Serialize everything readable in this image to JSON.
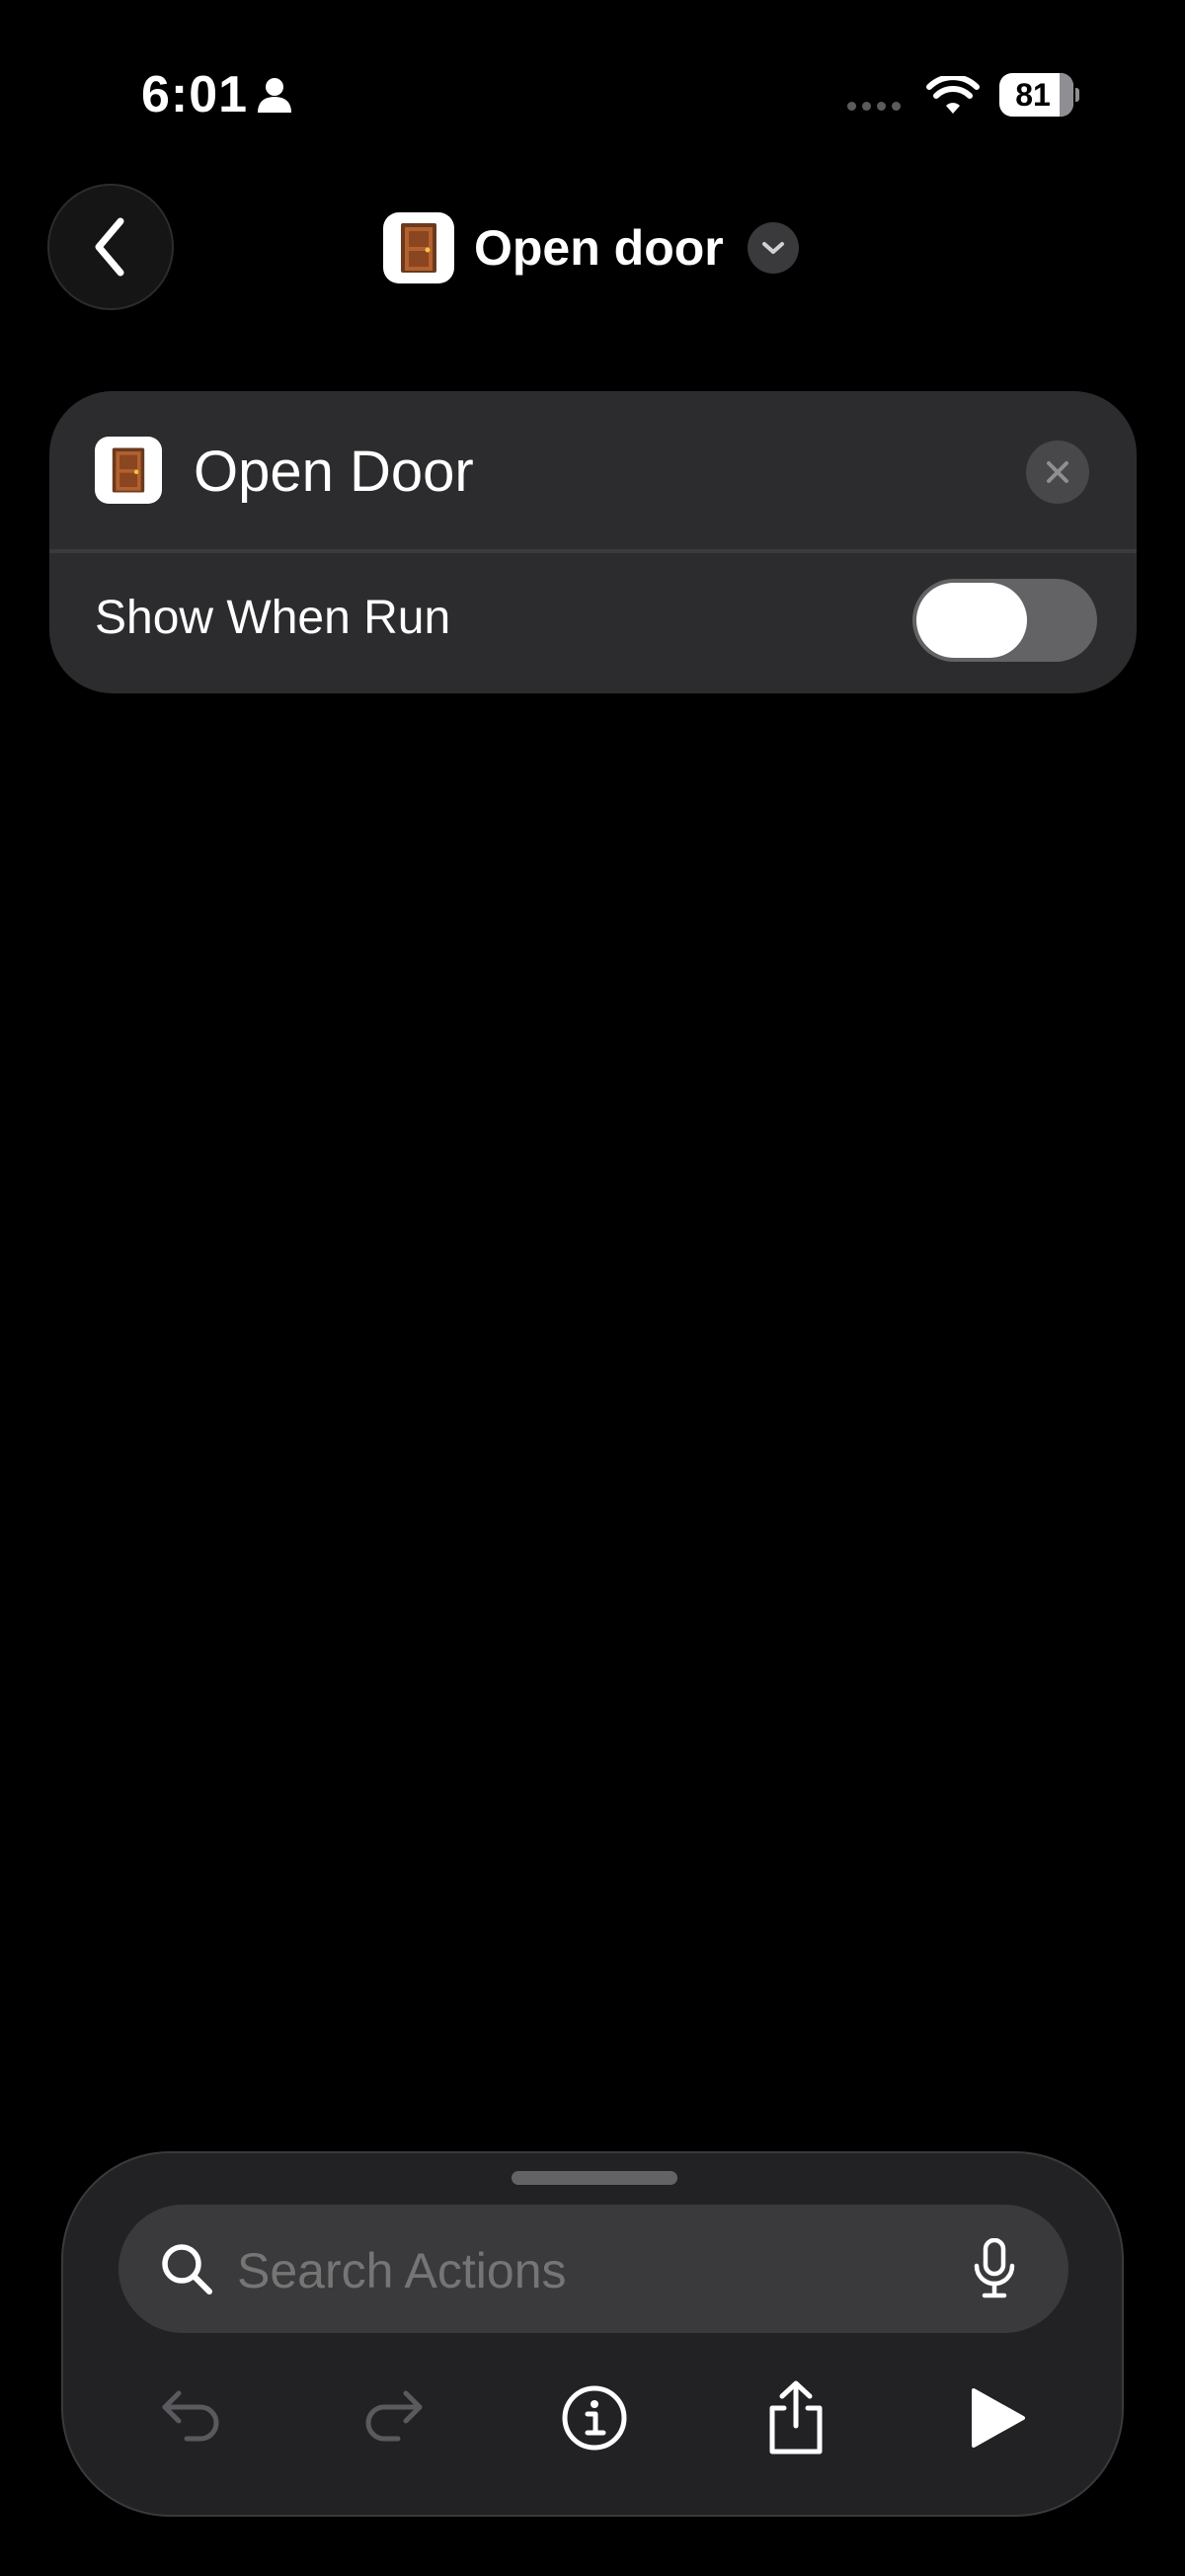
{
  "status_bar": {
    "time": "6:01",
    "battery_level": "81",
    "battery_fraction": 0.81
  },
  "nav": {
    "title": "Open door",
    "title_icon": "door-icon"
  },
  "action_card": {
    "title": "Open Door",
    "icon": "door-icon",
    "option_label": "Show When Run",
    "show_when_run": false
  },
  "bottom_panel": {
    "search_placeholder": "Search Actions",
    "toolbar_icons": [
      "undo-icon",
      "redo-icon",
      "info-icon",
      "share-icon",
      "play-icon"
    ]
  },
  "colors": {
    "background": "#000000",
    "card": "#2c2c2e",
    "door_wood": "#a0522d",
    "disabled_icon": "#5a5a5e"
  }
}
